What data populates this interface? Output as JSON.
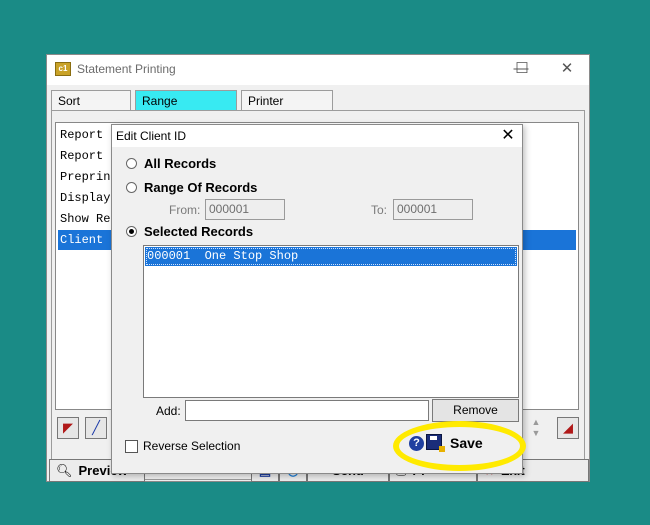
{
  "window": {
    "app_icon_text": "c1",
    "title": "Statement Printing",
    "minimize": "—",
    "maximize": "☐",
    "close": "✕"
  },
  "tabs": [
    {
      "label": "Sort Options"
    },
    {
      "label": "Range Selections",
      "active": true
    },
    {
      "label": "Printer Options"
    }
  ],
  "settings_list": [
    {
      "label": "Report D"
    },
    {
      "label": "Report E"
    },
    {
      "label": "Preprint"
    },
    {
      "label": "Display"
    },
    {
      "label": "Show Rec"
    },
    {
      "label": "Client I",
      "selected": true
    }
  ],
  "toolbar": {
    "preview": "Preview",
    "send": "Send",
    "print_partial": "Pr",
    "exit": "Exit"
  },
  "dialog": {
    "title": "Edit Client ID",
    "close": "✕",
    "options": {
      "all_records": "All Records",
      "range_of_records": "Range Of Records",
      "selected_records": "Selected Records",
      "selected": "selected_records"
    },
    "range": {
      "from_label": "From:",
      "from_value": "000001",
      "to_label": "To:",
      "to_value": "000001"
    },
    "records": [
      {
        "id": "000001",
        "name": "One Stop Shop",
        "display": "000001  One Stop Shop",
        "selected": true
      }
    ],
    "add_label": "Add:",
    "add_value": "",
    "remove_label": "Remove",
    "reverse_selection_label": "Reverse Selection",
    "reverse_selection_checked": false,
    "help_icon": "?",
    "save_label": "Save"
  },
  "colors": {
    "desktop": "#1a8b86",
    "active_tab": "#38eaf2",
    "selection": "#1a74d8",
    "highlight": "#ffea00"
  }
}
